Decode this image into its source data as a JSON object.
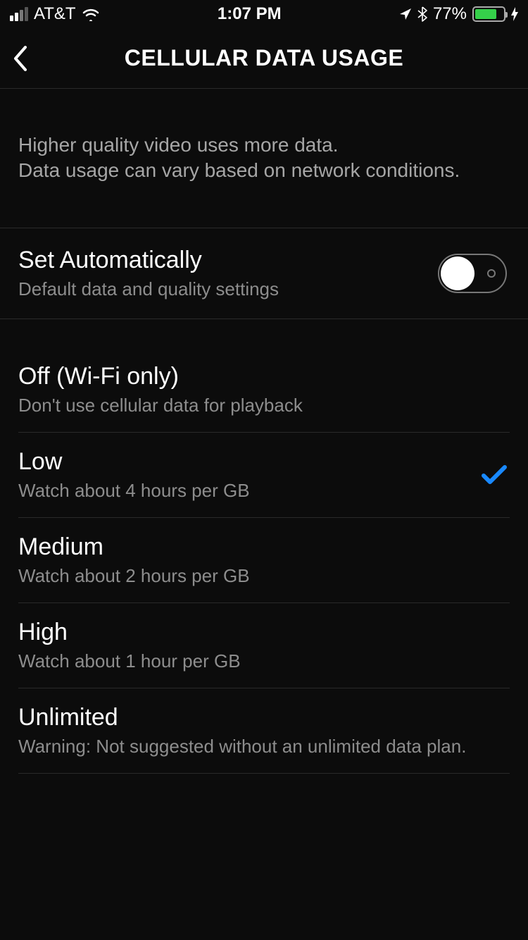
{
  "status_bar": {
    "carrier": "AT&T",
    "time": "1:07 PM",
    "battery_pct": "77%"
  },
  "header": {
    "title": "CELLULAR DATA USAGE"
  },
  "info": {
    "line1": "Higher quality video uses more data.",
    "line2": "Data usage can vary based on network conditions."
  },
  "auto": {
    "title": "Set Automatically",
    "subtitle": "Default data and quality settings",
    "enabled": false
  },
  "options": [
    {
      "title": "Off (Wi-Fi only)",
      "subtitle": "Don't use cellular data for playback",
      "selected": false
    },
    {
      "title": "Low",
      "subtitle": "Watch about 4 hours per GB",
      "selected": true
    },
    {
      "title": "Medium",
      "subtitle": "Watch about 2 hours per GB",
      "selected": false
    },
    {
      "title": "High",
      "subtitle": "Watch about 1 hour per GB",
      "selected": false
    },
    {
      "title": "Unlimited",
      "subtitle": "Warning: Not suggested without an unlimited data plan.",
      "selected": false
    }
  ]
}
